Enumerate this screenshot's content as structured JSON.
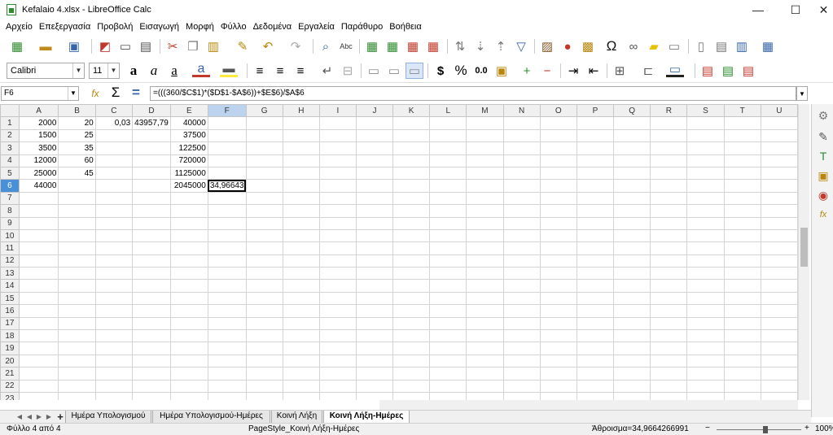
{
  "window": {
    "title": "Kefalaio 4.xlsx - LibreOffice Calc",
    "minimize": "—",
    "maximize": "☐",
    "close": "✕"
  },
  "menu": [
    "Αρχείο",
    "Επεξεργασία",
    "Προβολή",
    "Εισαγωγή",
    "Μορφή",
    "Φύλλο",
    "Δεδομένα",
    "Εργαλεία",
    "Παράθυρο",
    "Βοήθεια"
  ],
  "toolbar2": {
    "font_name": "Calibri",
    "font_size": "11",
    "currency": "$",
    "percent": "%",
    "decimal": "0.0"
  },
  "formula_bar": {
    "cell_ref": "F6",
    "formula": "=(((360/$C$1)*($D$1-$A$6))+$E$6)/$A$6",
    "sum_symbol": "Σ",
    "equals": "="
  },
  "grid": {
    "columns": [
      "A",
      "B",
      "C",
      "D",
      "E",
      "F",
      "G",
      "H",
      "I",
      "J",
      "K",
      "L",
      "M",
      "N",
      "O",
      "P",
      "Q",
      "R",
      "S",
      "T",
      "U"
    ],
    "rows": [
      [
        "2000",
        "20",
        "0,03",
        "43957,79",
        "40000",
        ""
      ],
      [
        "1500",
        "25",
        "",
        "",
        "37500",
        ""
      ],
      [
        "3500",
        "35",
        "",
        "",
        "122500",
        ""
      ],
      [
        "12000",
        "60",
        "",
        "",
        "720000",
        ""
      ],
      [
        "25000",
        "45",
        "",
        "",
        "1125000",
        ""
      ],
      [
        "44000",
        "",
        "",
        "",
        "2045000",
        "34,96643"
      ],
      [],
      [],
      [],
      [],
      [],
      [],
      [],
      [],
      [],
      [],
      [],
      [],
      [],
      [],
      [],
      [],
      [],
      []
    ],
    "active_cell": "F6"
  },
  "sheet_tabs": [
    "Ημέρα Υπολογισμού",
    "Ημέρα Υπολογισμού-Ημέρες",
    "Κοινή Λήξη",
    "Κοινή Λήξη-Ημέρες"
  ],
  "active_tab": "Κοινή Λήξη-Ημέρες",
  "status": {
    "sheet": "Φύλλο 4 από 4",
    "page_style": "PageStyle_Κοινή Λήξη-Ημέρες",
    "sum": "Άθροισμα=34,9664266991",
    "zoom": "100%"
  }
}
